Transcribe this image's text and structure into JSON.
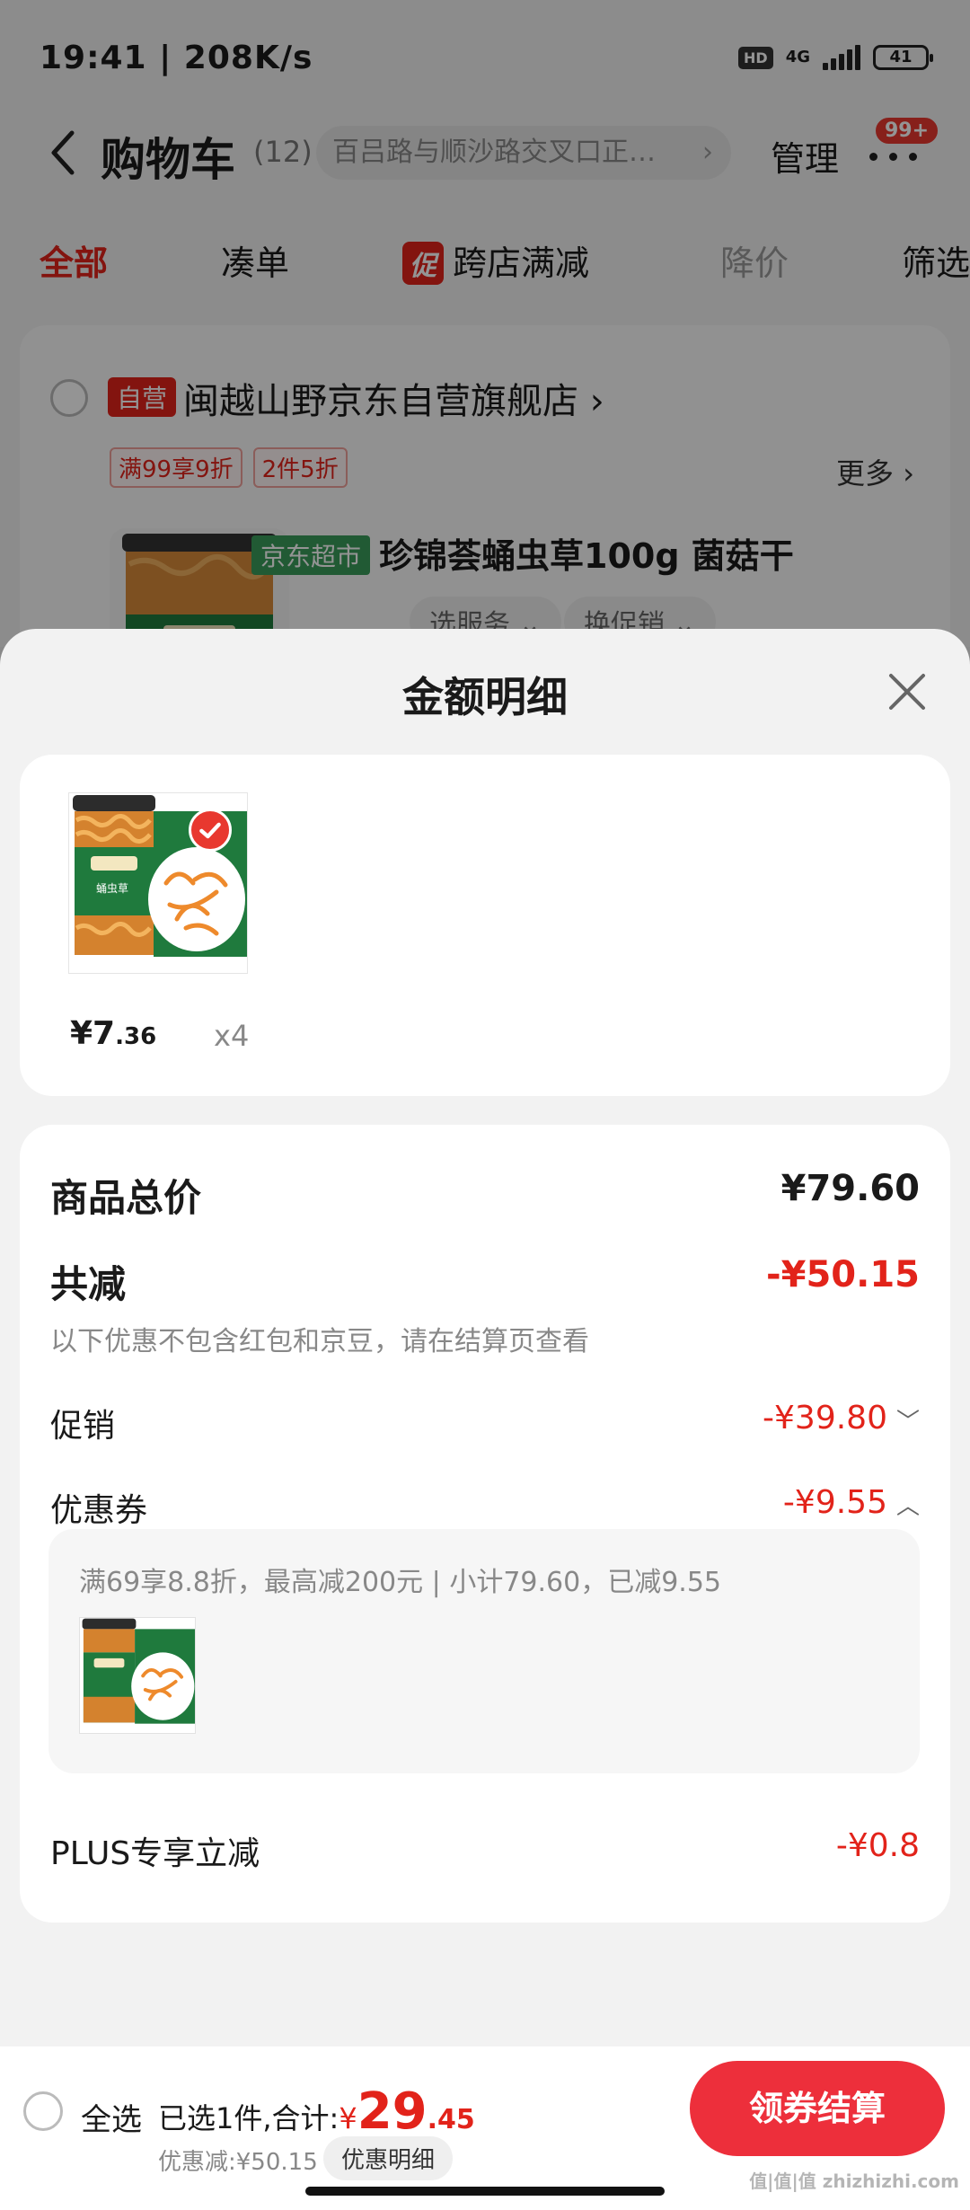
{
  "status_bar": {
    "time": "19:41 | 208K/s",
    "hd": "HD",
    "network": "4G",
    "battery": "41"
  },
  "header": {
    "title": "购物车",
    "count": "(12)",
    "address": "百吕路与顺沙路交叉口正…",
    "address_chevron": "›",
    "manage": "管理",
    "badge": "99+"
  },
  "tabs": {
    "all": "全部",
    "bundle": "凑单",
    "promo_tag": "促",
    "cross_store": "跨店满减",
    "price_drop": "降价",
    "filter": "筛选"
  },
  "store": {
    "self_tag": "自营",
    "name": "闽越山野京东自营旗舰店",
    "name_chevron": "›",
    "deals": [
      "满99享9折",
      "2件5折"
    ],
    "more": "更多 ›",
    "channel_tag": "京东超市",
    "product_title": "珍锦荟蛹虫草100g 菌菇干",
    "service_pill": "选服务 ⌄",
    "promo_pill": "换促销 ⌄"
  },
  "sheet": {
    "title": "金额明细",
    "item": {
      "price_int": "¥7",
      "price_dec": ".36",
      "qty": "x4"
    },
    "rows": {
      "total_label": "商品总价",
      "total_value": "¥79.60",
      "discount_label": "共减",
      "discount_value": "-¥50.15",
      "note": "以下优惠不包含红包和京豆，请在结算页查看",
      "promo_label": "促销",
      "promo_value": "-¥39.80",
      "promo_caret": "﹀",
      "coupon_label": "优惠券",
      "coupon_value": "-¥9.55",
      "coupon_caret": "︿",
      "coupon_detail": "满69享8.8折，最高减200元 | 小计79.60，已减9.55",
      "plus_label": "PLUS专享立减",
      "plus_value": "-¥0.8"
    }
  },
  "bottom": {
    "select_all": "全选",
    "sum_label": "已选1件,合计:",
    "sum_yen": "¥",
    "sum_int": "29",
    "sum_dec": ".45",
    "discount_line": "优惠减:¥50.15",
    "detail_pill": "优惠明细",
    "checkout": "领券结算"
  },
  "watermark": "值|值|值 zhizhizhi.com",
  "colors": {
    "accent_red": "#e2231a",
    "button_red": "#ed2f3b",
    "jd_super_green": "#3a9c5a"
  }
}
